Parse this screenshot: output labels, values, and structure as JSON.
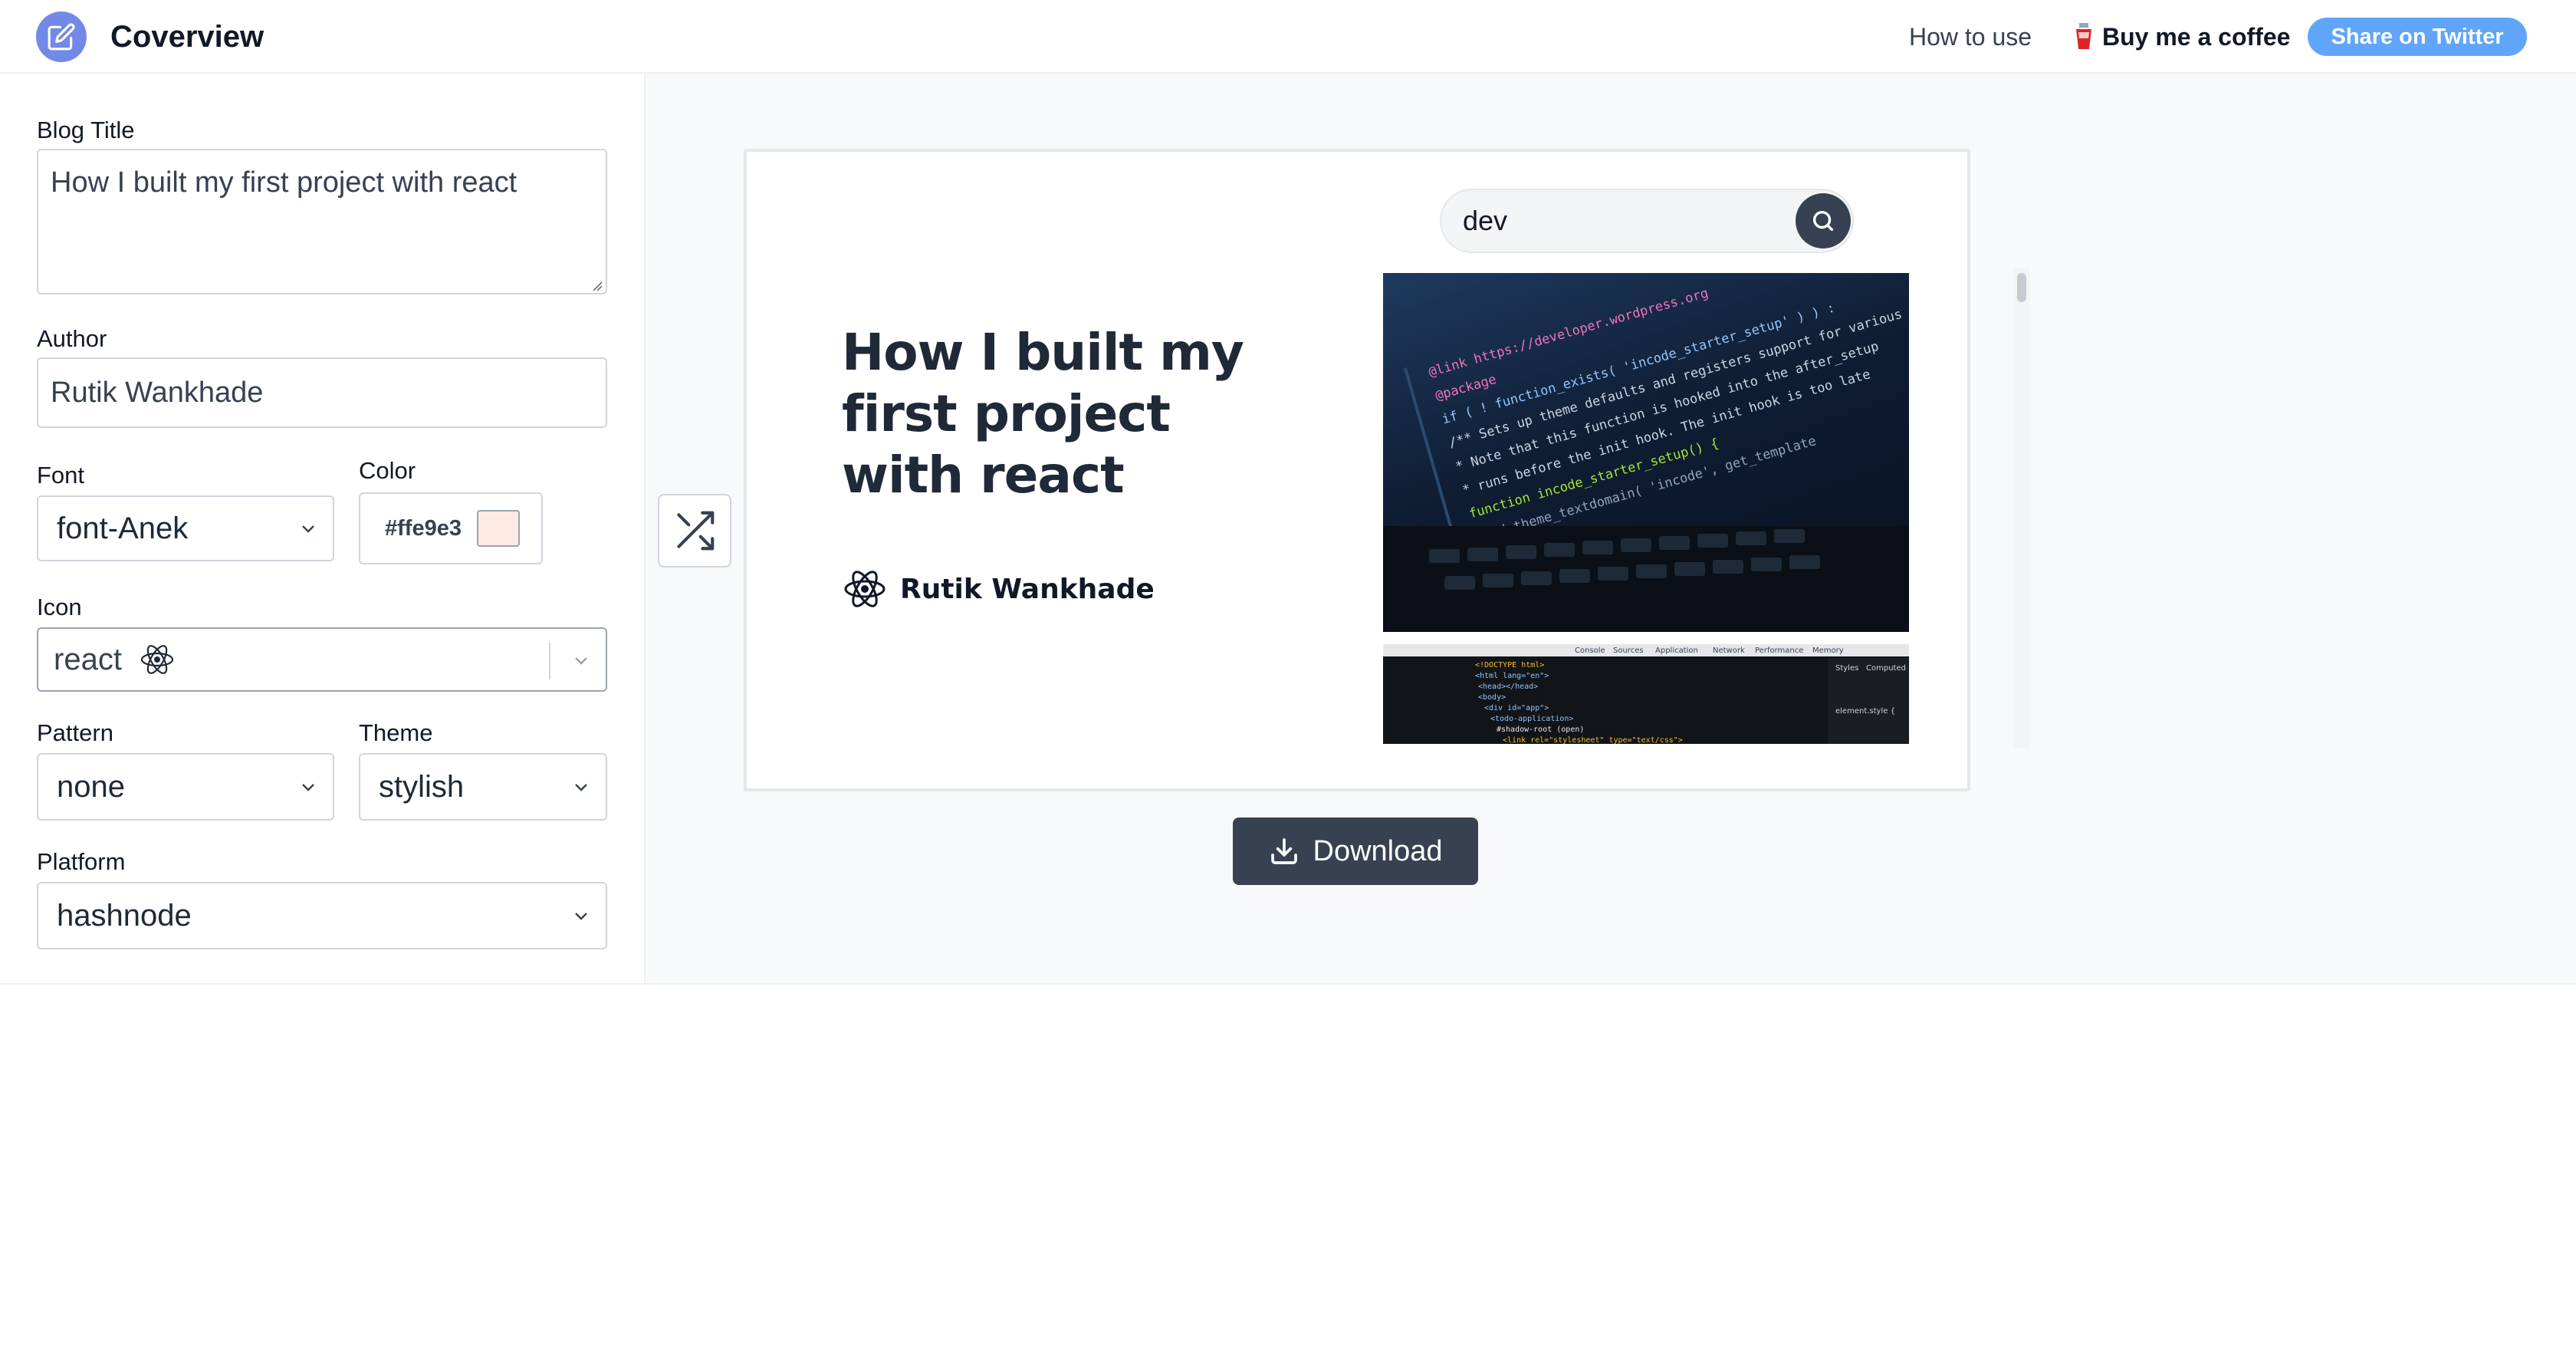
{
  "header": {
    "brand": "Coverview",
    "how_to_use": "How to use",
    "buy_coffee": "Buy me a coffee",
    "share": "Share on Twitter"
  },
  "sidebar": {
    "blog_title_label": "Blog Title",
    "blog_title_value": "How I built my first project with react",
    "author_label": "Author",
    "author_value": "Rutik Wankhade",
    "font_label": "Font",
    "font_value": "font-Anek",
    "color_label": "Color",
    "color_value": "#ffe9e3",
    "icon_label": "Icon",
    "icon_value": "react",
    "pattern_label": "Pattern",
    "pattern_value": "none",
    "theme_label": "Theme",
    "theme_value": "stylish",
    "platform_label": "Platform",
    "platform_value": "hashnode"
  },
  "preview": {
    "title": "How I built my first project with react",
    "author": "Rutik Wankhade",
    "search_value": "dev",
    "download": "Download"
  },
  "colors": {
    "brand": "#7289e8",
    "share": "#60a5fa",
    "dark_button": "#374151",
    "swatch": "#ffe9e3"
  }
}
